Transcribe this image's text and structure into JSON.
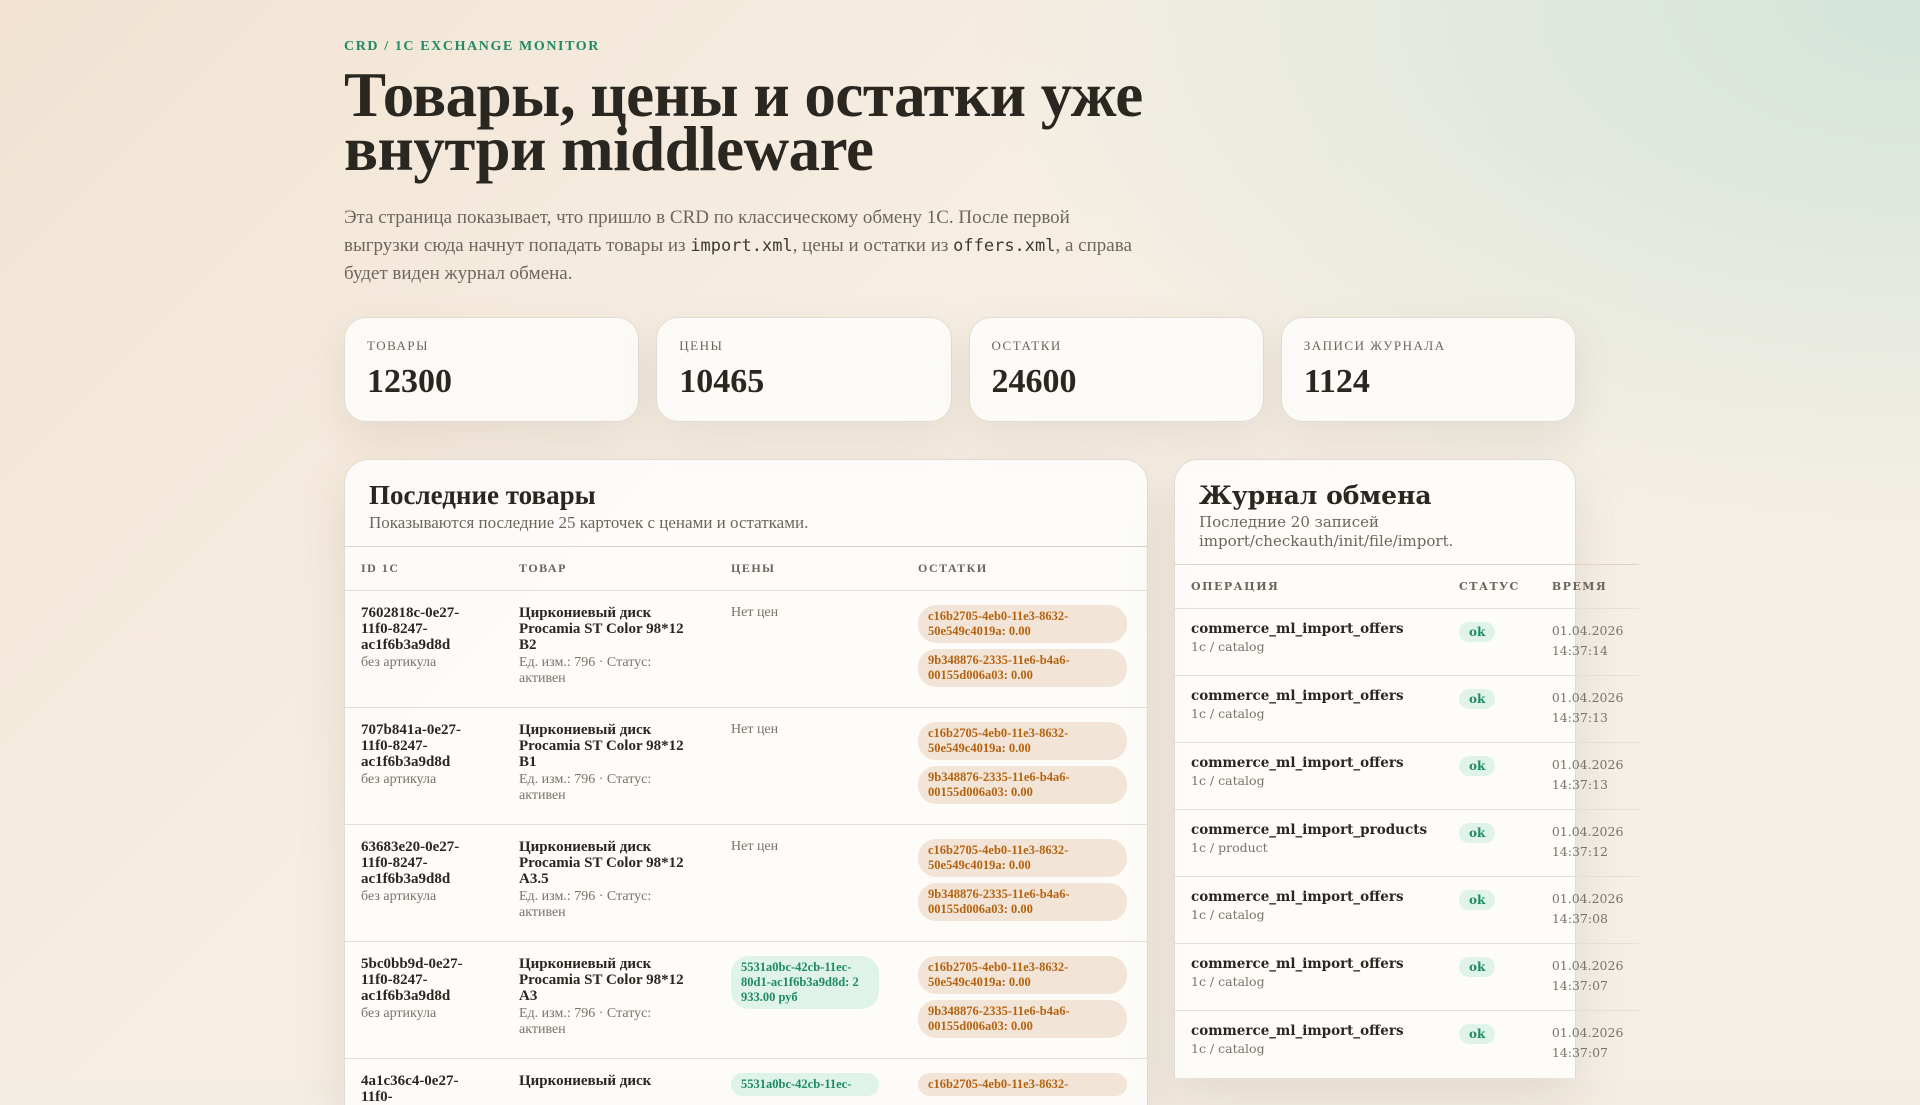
{
  "eyebrow": "CRD / 1C EXCHANGE MONITOR",
  "title": "Товары, цены и остатки уже внутри middleware",
  "lead": {
    "p1": "Эта страница показывает, что пришло в CRD по классическому обмену 1С. После первой выгрузки сюда начнут попадать товары из ",
    "c1": "import.xml",
    "p2": ", цены и остатки из ",
    "c2": "offers.xml",
    "p3": ", а справа будет виден журнал обмена."
  },
  "stats": [
    {
      "label": "ТОВАРЫ",
      "value": "12300"
    },
    {
      "label": "ЦЕНЫ",
      "value": "10465"
    },
    {
      "label": "ОСТАТКИ",
      "value": "24600"
    },
    {
      "label": "ЗАПИСИ ЖУРНАЛА",
      "value": "1124"
    }
  ],
  "products": {
    "title": "Последние товары",
    "subtitle": "Показываются последние 25 карточек с ценами и остатками.",
    "columns": [
      "ID 1C",
      "ТОВАР",
      "ЦЕНЫ",
      "ОСТАТКИ"
    ],
    "rows": [
      {
        "id": "7602818c-0e27-11f0-8247-ac1f6b3a9d8d",
        "sku": "без артикула",
        "name": "Циркониевый диск Procamia ST Color 98*12 B2",
        "meta": "Ед. изм.: 796 · Статус: активен",
        "prices": [],
        "no_price": "Нет цен",
        "stocks": [
          "c16b2705-4eb0-11e3-8632-50e549c4019a: 0.00",
          "9b348876-2335-11e6-b4a6-00155d006a03: 0.00"
        ]
      },
      {
        "id": "707b841a-0e27-11f0-8247-ac1f6b3a9d8d",
        "sku": "без артикула",
        "name": "Циркониевый диск Procamia ST Color 98*12 B1",
        "meta": "Ед. изм.: 796 · Статус: активен",
        "prices": [],
        "no_price": "Нет цен",
        "stocks": [
          "c16b2705-4eb0-11e3-8632-50e549c4019a: 0.00",
          "9b348876-2335-11e6-b4a6-00155d006a03: 0.00"
        ]
      },
      {
        "id": "63683e20-0e27-11f0-8247-ac1f6b3a9d8d",
        "sku": "без артикула",
        "name": "Циркониевый диск Procamia ST Color 98*12 A3.5",
        "meta": "Ед. изм.: 796 · Статус: активен",
        "prices": [],
        "no_price": "Нет цен",
        "stocks": [
          "c16b2705-4eb0-11e3-8632-50e549c4019a: 0.00",
          "9b348876-2335-11e6-b4a6-00155d006a03: 0.00"
        ]
      },
      {
        "id": "5bc0bb9d-0e27-11f0-8247-ac1f6b3a9d8d",
        "sku": "без артикула",
        "name": "Циркониевый диск Procamia ST Color 98*12 A3",
        "meta": "Ед. изм.: 796 · Статус: активен",
        "prices": [
          "5531a0bc-42cb-11ec-80d1-ac1f6b3a9d8d: 2 933.00 руб"
        ],
        "no_price": "",
        "stocks": [
          "c16b2705-4eb0-11e3-8632-50e549c4019a: 0.00",
          "9b348876-2335-11e6-b4a6-00155d006a03: 0.00"
        ]
      },
      {
        "id": "4a1c36c4-0e27-11f0-",
        "sku": "",
        "name": "Циркониевый диск",
        "meta": "",
        "prices": [
          "5531a0bc-42cb-11ec-"
        ],
        "no_price": "",
        "stocks": [
          "c16b2705-4eb0-11e3-8632-"
        ]
      }
    ]
  },
  "journal": {
    "title": "Журнал обмена",
    "subtitle": "Последние 20 записей import/checkauth/init/file/import.",
    "columns": [
      "ОПЕРАЦИЯ",
      "СТАТУС",
      "ВРЕМЯ"
    ],
    "rows": [
      {
        "op": "commerce_ml_import_offers",
        "sub": "1c / catalog",
        "status": "ok",
        "date": "01.04.2026",
        "time": "14:37:14"
      },
      {
        "op": "commerce_ml_import_offers",
        "sub": "1c / catalog",
        "status": "ok",
        "date": "01.04.2026",
        "time": "14:37:13"
      },
      {
        "op": "commerce_ml_import_offers",
        "sub": "1c / catalog",
        "status": "ok",
        "date": "01.04.2026",
        "time": "14:37:13"
      },
      {
        "op": "commerce_ml_import_products",
        "sub": "1c / product",
        "status": "ok",
        "date": "01.04.2026",
        "time": "14:37:12"
      },
      {
        "op": "commerce_ml_import_offers",
        "sub": "1c / catalog",
        "status": "ok",
        "date": "01.04.2026",
        "time": "14:37:08"
      },
      {
        "op": "commerce_ml_import_offers",
        "sub": "1c / catalog",
        "status": "ok",
        "date": "01.04.2026",
        "time": "14:37:07"
      },
      {
        "op": "commerce_ml_import_offers",
        "sub": "1c / catalog",
        "status": "ok",
        "date": "01.04.2026",
        "time": "14:37:07"
      }
    ]
  },
  "colors": {
    "accent": "#1f8a63",
    "price_bg": "#dff3ea",
    "stock_bg": "#f2e5d8",
    "stock_fg": "#b5620f"
  }
}
